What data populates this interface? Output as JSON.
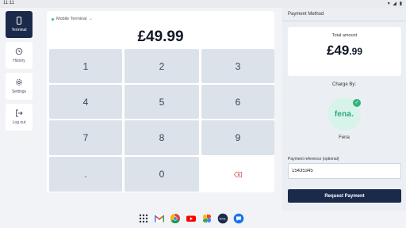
{
  "status_bar": {
    "time": "11:11",
    "icons": "▾ ◢ ▮"
  },
  "sidebar": {
    "items": [
      {
        "label": "Terminal",
        "icon": "tablet-icon",
        "active": true
      },
      {
        "label": "History",
        "icon": "history-icon"
      },
      {
        "label": "Settings",
        "icon": "gear-icon"
      },
      {
        "label": "Log out",
        "icon": "logout-icon"
      }
    ]
  },
  "terminal": {
    "selector_label": "Mobile Terminal",
    "amount": "£49.99",
    "keys": [
      "1",
      "2",
      "3",
      "4",
      "5",
      "6",
      "7",
      "8",
      "9",
      ".",
      "0",
      ""
    ],
    "backspace_icon": "backspace-icon"
  },
  "payment_method": {
    "title": "Payment Method",
    "total_label": "Total amount",
    "total_main": "£49",
    "total_pence": ".99",
    "charge_by_label": "Charge By:",
    "provider_logo_text": "fena.",
    "provider_name": "Fena",
    "reference_label": "Payment reference (optional)",
    "reference_value": "15435345",
    "request_button": "Request Payment"
  },
  "dock": {
    "apps": [
      "apps-grid-icon",
      "gmail-icon",
      "chrome-icon",
      "youtube-icon",
      "photos-icon",
      "fena-app-icon",
      "messages-icon"
    ]
  },
  "colors": {
    "primary": "#1b2a4a",
    "accent_green": "#2fb57c",
    "key_bg": "#dce2ea",
    "panel_bg": "#ebeef3"
  }
}
